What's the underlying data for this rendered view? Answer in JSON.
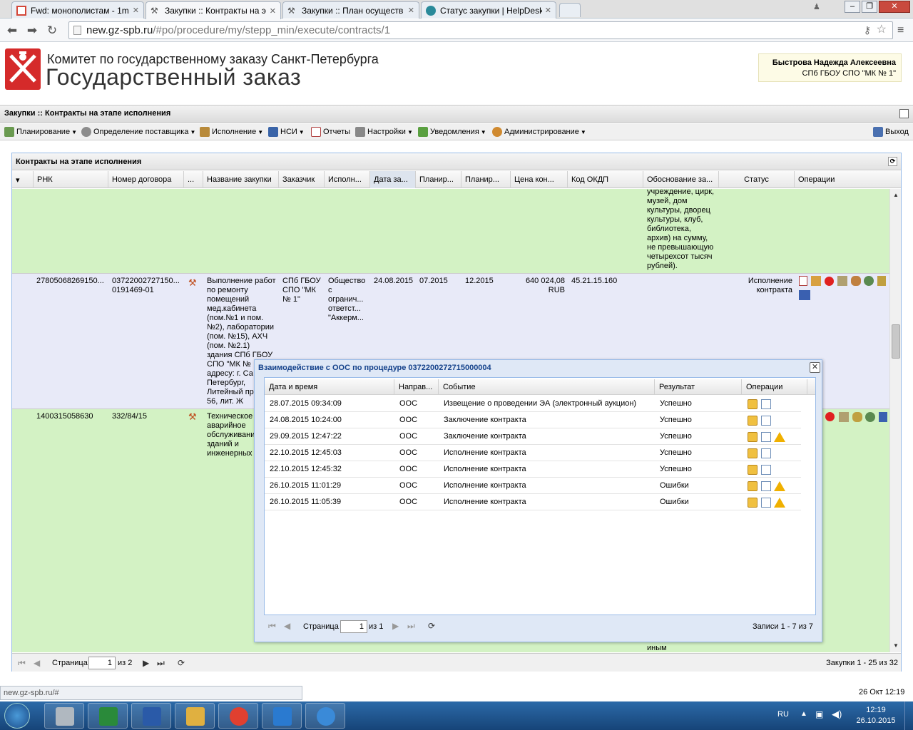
{
  "browser": {
    "tabs": [
      {
        "title": "Fwd: монополистам - 1m",
        "icon": "gmail-icon",
        "color": "#d44638"
      },
      {
        "title": "Закупки :: Контракты на э",
        "icon": "gavel-icon",
        "color": "#555555"
      },
      {
        "title": "Закупки :: План осуществ",
        "icon": "gavel-icon",
        "color": "#555555"
      },
      {
        "title": "Статус закупки | HelpDesk",
        "icon": "helpdesk-icon",
        "color": "#2a8a9a"
      }
    ],
    "url_host": "new.gz-spb.ru",
    "url_path": "/#po/procedure/my/stepp_min/execute/contracts/1",
    "status_url": "new.gz-spb.ru/#",
    "datetime_status": "26 Окт 12:19"
  },
  "header": {
    "org": "Комитет по государственному заказу Санкт-Петербурга",
    "title": "Государственный заказ",
    "user_name": "Быстрова Надежда Алексеевна",
    "user_org": "СПб ГБОУ СПО \"МК № 1\""
  },
  "panel_title": "Закупки :: Контракты на этапе исполнения",
  "menu": {
    "items": [
      "Планирование",
      "Определение поставщика",
      "Исполнение",
      "НСИ",
      "Отчеты",
      "Настройки",
      "Уведомления",
      "Администрирование"
    ],
    "logout": "Выход"
  },
  "grid": {
    "title": "Контракты на этапе исполнения",
    "columns": [
      "РНК",
      "Номер договора",
      "...",
      "Название закупки",
      "Заказчик",
      "Исполн...",
      "Дата за...",
      "Планир...",
      "Планир...",
      "Цена кон...",
      "Код ОКДП",
      "Обоснование за...",
      "Статус",
      "Операции"
    ],
    "row0_justification": "учреждение, цирк,\nмузей, дом\nкультуры, дворец\nкультуры, клуб,\nбиблиотека,\nархив) на сумму,\nне превышающую\nчетырехсот тысяч\nрублей).",
    "row1": {
      "rnk": "27805068269150...",
      "contract": "03722002727150...\n0191469-01",
      "name": "Выполнение работ\nпо ремонту\nпомещений\nмед.кабинета\n(пом.№1 и пом.\n№2), лаборатории\n(пом. №15), АХЧ\n(пом. №2.1)\nздания СПб ГБОУ\nСПО \"МК №\nадресу: г. Са\nПетербург,\nЛитейный пр\n56, лит. Ж",
      "customer": "СПб ГБОУ\nСПО \"МК\n№ 1\"",
      "executor": "Общество\nс\nогранич...\nответст...\n\"Аккерм...",
      "date": "24.08.2015",
      "plan1": "07.2015",
      "plan2": "12.2015",
      "price": "640 024,08\nRUB",
      "okdp": "45.21.15.160",
      "status": "Исполнение\nконтракта"
    },
    "row2": {
      "rnk": "1400315058630",
      "contract": "332/84/15",
      "name": "Техническое\nаварийное\nобслуживани\nзданий и\nинженерных",
      "tail": "иным"
    },
    "footer": {
      "page_label": "Страница",
      "page": "1",
      "of": "из 2",
      "records": "Закупки 1 - 25 из 32"
    }
  },
  "modal": {
    "title": "Взаимодействие с ООС по процедуре 0372200272715000004",
    "columns": [
      "Дата и время",
      "Направ...",
      "Событие",
      "Результат",
      "Операции"
    ],
    "rows": [
      {
        "date": "28.07.2015 09:34:09",
        "dir": "ООС",
        "event": "Извещение о проведении ЭА (электронный аукцион)",
        "result": "Успешно",
        "warn": false
      },
      {
        "date": "24.08.2015 10:24:00",
        "dir": "ООС",
        "event": "Заключение контракта",
        "result": "Успешно",
        "warn": false
      },
      {
        "date": "29.09.2015 12:47:22",
        "dir": "ООС",
        "event": "Заключение контракта",
        "result": "Успешно",
        "warn": true
      },
      {
        "date": "22.10.2015 12:45:03",
        "dir": "ООС",
        "event": "Исполнение контракта",
        "result": "Успешно",
        "warn": false
      },
      {
        "date": "22.10.2015 12:45:32",
        "dir": "ООС",
        "event": "Исполнение контракта",
        "result": "Успешно",
        "warn": false
      },
      {
        "date": "26.10.2015 11:01:29",
        "dir": "ООС",
        "event": "Исполнение контракта",
        "result": "Ошибки",
        "warn": true
      },
      {
        "date": "26.10.2015 11:05:39",
        "dir": "ООС",
        "event": "Исполнение контракта",
        "result": "Ошибки",
        "warn": true
      }
    ],
    "footer": {
      "page_label": "Страница",
      "page": "1",
      "of": "из 1",
      "records": "Записи 1 - 7 из 7"
    }
  },
  "taskbar": {
    "lang": "RU",
    "time": "12:19",
    "date": "26.10.2015",
    "apps": [
      "calculator-icon",
      "excel-icon",
      "word-icon",
      "explorer-icon",
      "chrome-icon",
      "teamviewer-icon",
      "ie-icon"
    ]
  },
  "colors": {
    "row_green": "#d3f2c4",
    "row_selected": "#e8eaf8",
    "brand_red": "#d52a2a",
    "taskbar": "#1d4f86"
  }
}
